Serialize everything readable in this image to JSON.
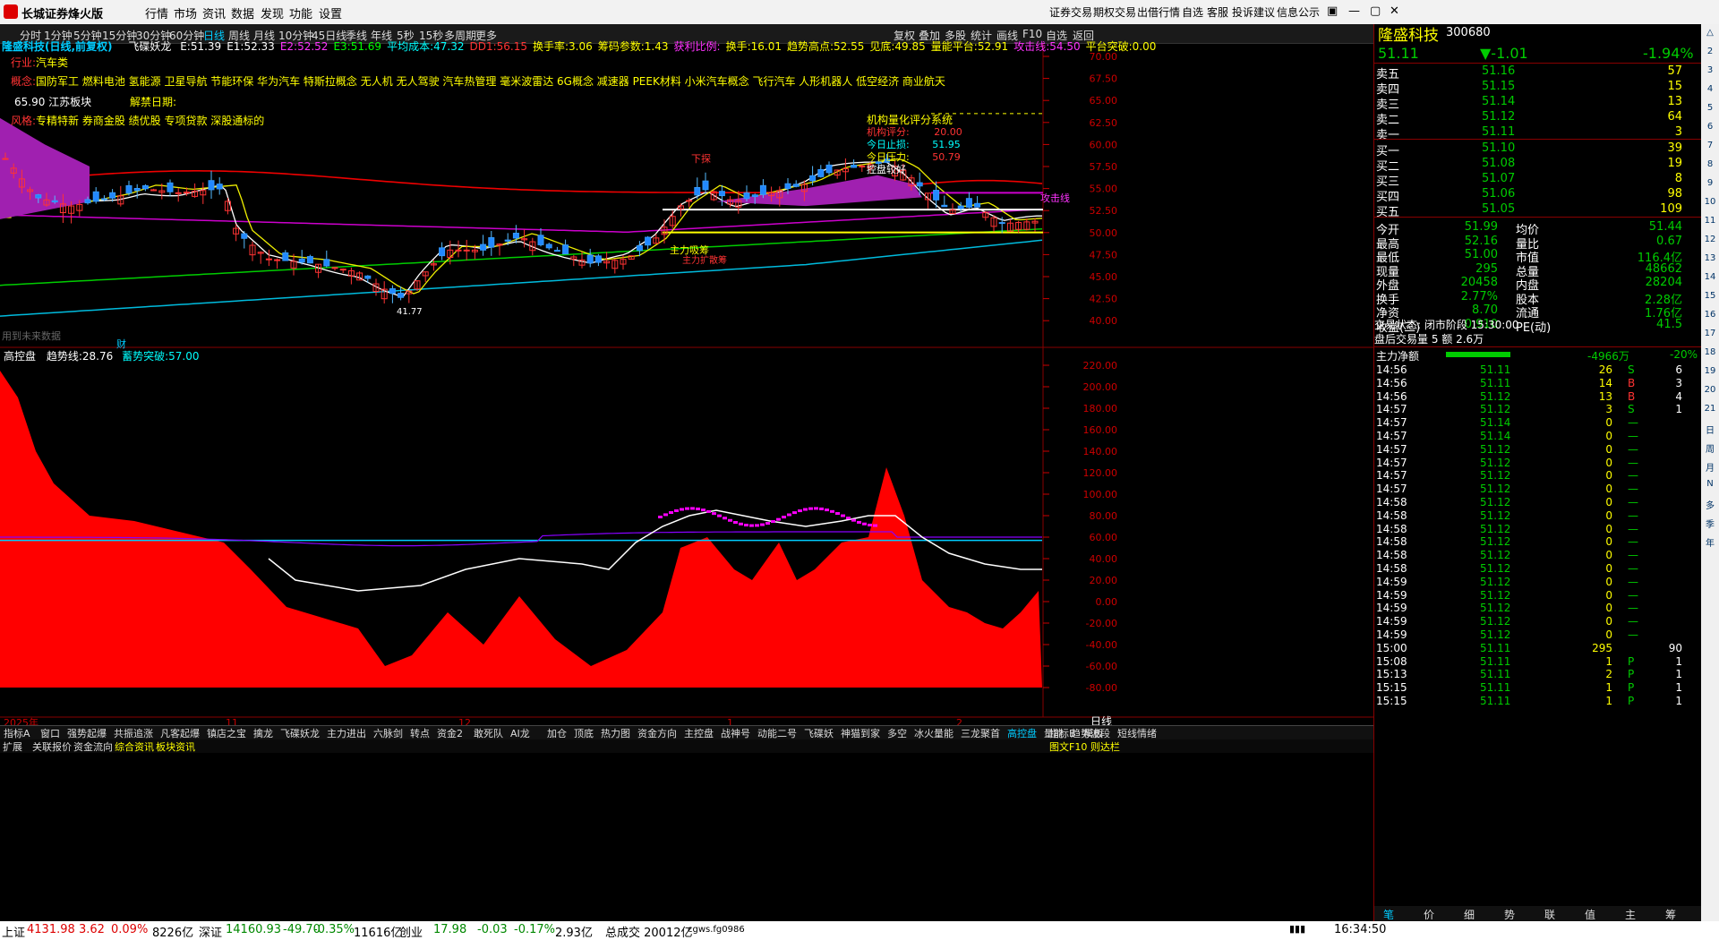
{
  "app": {
    "title": "长城证券烽火版",
    "menu": [
      "行情",
      "市场",
      "资讯",
      "数据",
      "发现",
      "功能",
      "设置"
    ],
    "links": [
      "证券交易",
      "期权交易",
      "出借行情",
      "自选",
      "客服",
      "投诉建议",
      "信息公示"
    ]
  },
  "toolbar": {
    "periods": [
      "分时",
      "1分钟",
      "5分钟",
      "15分钟",
      "30分钟",
      "60分钟",
      "日线",
      "周线",
      "月线",
      "10分钟",
      "45日线",
      "季线",
      "年线",
      "5秒",
      "15秒",
      "多周期",
      "更多"
    ],
    "right": [
      "复权",
      "叠加",
      "多股",
      "统计",
      "画线",
      "F10",
      "自选",
      "返回"
    ]
  },
  "main_info": {
    "name": "隆盛科技(日线,前复权)",
    "indicator": "飞碟妖龙",
    "values": [
      {
        "k": "E:",
        "v": "51.39",
        "c": "#fff"
      },
      {
        "k": "E1:",
        "v": "52.33",
        "c": "#fff"
      },
      {
        "k": "E2:",
        "v": "52.52",
        "c": "#f3f"
      },
      {
        "k": "E3:",
        "v": "51.69",
        "c": "#0f0"
      },
      {
        "k": "平均成本:",
        "v": "47.32",
        "c": "#0ff"
      },
      {
        "k": "DD1:",
        "v": "56.15",
        "c": "#f33"
      },
      {
        "k": "换手率:",
        "v": "3.06",
        "c": "#ff0"
      },
      {
        "k": "筹码参数:",
        "v": "1.43",
        "c": "#ff0"
      },
      {
        "k": "获利比例:",
        "v": "",
        "c": "#f3f"
      },
      {
        "k": "换手:",
        "v": "16.01",
        "c": "#ff0"
      },
      {
        "k": "趋势高点:",
        "v": "52.55",
        "c": "#ff0"
      },
      {
        "k": "见底:",
        "v": "49.85",
        "c": "#ff0"
      },
      {
        "k": "量能平台:",
        "v": "52.91",
        "c": "#ff0"
      },
      {
        "k": "攻击线:",
        "v": "54.50",
        "c": "#f3f"
      },
      {
        "k": "平台突破:",
        "v": "0.00",
        "c": "#ff0"
      }
    ],
    "industry_label": "行业:",
    "industry": "汽车类",
    "concept_label": "概念:",
    "concepts": "国防军工 燃料电池 氢能源 卫星导航 节能环保 华为汽车 特斯拉概念 无人机 无人驾驶 汽车热管理 毫米波雷达 6G概念 减速器 PEEK材料 小米汽车概念 飞行汽车 人形机器人 低空经济 商业航天",
    "region": "65.90 江苏板块",
    "unlock": "解禁日期:",
    "style_label": "风格:",
    "styles": "专精特新 券商金股 绩优股 专项贷款 深股通标的",
    "system": "机构量化评分系统",
    "inst_label": "机构评分:",
    "inst": "20.00",
    "today_label1": "今日止损:",
    "today1": "51.95",
    "today_label2": "今日压力:",
    "today2": "50.79",
    "control": "控盘较好",
    "attack": "攻击线",
    "xiatan": "下探",
    "zhuli": "主力吸筹",
    "zhulibig": "主力扩散筹",
    "low": "41.77",
    "future": "用到未来数据",
    "cai": "财"
  },
  "y_axis_main": [
    "70.00",
    "67.50",
    "65.00",
    "62.50",
    "60.00",
    "57.50",
    "55.00",
    "52.50",
    "50.00",
    "47.50",
    "45.00",
    "42.50",
    "40.00"
  ],
  "sub_info": {
    "name": "高控盘",
    "k1": "趋势线:",
    "v1": "28.76",
    "k2": "蓄势突破:",
    "v2": "57.00"
  },
  "y_axis_sub": [
    "220.00",
    "200.00",
    "180.00",
    "160.00",
    "140.00",
    "120.00",
    "100.00",
    "80.00",
    "60.00",
    "40.00",
    "20.00",
    "0.00",
    "-20.00",
    "-40.00",
    "-60.00",
    "-80.00"
  ],
  "x_axis": [
    "2025年",
    "11",
    "12",
    "1",
    "2"
  ],
  "period_label": "日线",
  "indicator_tabs": [
    "指标A",
    "窗口",
    "强势起爆",
    "共振追涨",
    "凡客起爆",
    "镇店之宝",
    "擒龙",
    "飞碟妖龙",
    "主力进出",
    "六脉剑",
    "转点",
    "资金2",
    "敢死队",
    "AI龙",
    "加仓",
    "顶底",
    "热力图",
    "资金方向",
    "主控盘",
    "战神号",
    "动能二号",
    "飞碟妖",
    "神猫到家",
    "多空",
    "冰火量能",
    "三龙聚首",
    "高控盘",
    "量能",
    "趋势波段",
    "短线情绪"
  ],
  "indicator_right": [
    "指标B",
    "模板"
  ],
  "bottom_tabs": [
    "扩展",
    "关联报价",
    "资金流向",
    "综合资讯",
    "板块资讯"
  ],
  "bottom_right": "图文F10 则达栏",
  "stock": {
    "name": "隆盛科技",
    "code": "300680",
    "price": "51.11",
    "change": "▼-1.01",
    "pct": "-1.94%"
  },
  "asks": [
    {
      "l": "卖五",
      "p": "51.16",
      "v": "57"
    },
    {
      "l": "卖四",
      "p": "51.15",
      "v": "15"
    },
    {
      "l": "卖三",
      "p": "51.14",
      "v": "13"
    },
    {
      "l": "卖二",
      "p": "51.12",
      "v": "64"
    },
    {
      "l": "卖一",
      "p": "51.11",
      "v": "3"
    }
  ],
  "bids": [
    {
      "l": "买一",
      "p": "51.10",
      "v": "39"
    },
    {
      "l": "买二",
      "p": "51.08",
      "v": "19"
    },
    {
      "l": "买三",
      "p": "51.07",
      "v": "8"
    },
    {
      "l": "买四",
      "p": "51.06",
      "v": "98"
    },
    {
      "l": "买五",
      "p": "51.05",
      "v": "109"
    }
  ],
  "stats": [
    {
      "a": "今开",
      "b": "51.99",
      "c": "均价",
      "d": "51.44"
    },
    {
      "a": "最高",
      "b": "52.16",
      "c": "量比",
      "d": "0.67"
    },
    {
      "a": "最低",
      "b": "51.00",
      "c": "市值",
      "d": "116.4亿"
    },
    {
      "a": "现量",
      "b": "295",
      "c": "总量",
      "d": "48662"
    },
    {
      "a": "外盘",
      "b": "20458",
      "c": "内盘",
      "d": "28204"
    },
    {
      "a": "换手",
      "b": "2.77%",
      "c": "股本",
      "d": "2.28亿"
    },
    {
      "a": "净资",
      "b": "8.70",
      "c": "流通",
      "d": "1.76亿"
    },
    {
      "a": "收益(三)",
      "b": "0.910",
      "c": "PE(动)",
      "d": "41.5"
    }
  ],
  "trade_status": "交易状态: 闭市阶段 15:30:00",
  "after": "盘后交易量 5 额 2.6万",
  "net_label": "主力净额",
  "net_val": "-4966万",
  "net_pct": "-20%",
  "ticks": [
    [
      "14:56",
      "51.11",
      "26",
      "S",
      "6"
    ],
    [
      "14:56",
      "51.11",
      "14",
      "B",
      "3"
    ],
    [
      "14:56",
      "51.12",
      "13",
      "B",
      "4"
    ],
    [
      "14:57",
      "51.12",
      "3",
      "S",
      "1"
    ],
    [
      "14:57",
      "51.14",
      "0",
      "—",
      ""
    ],
    [
      "14:57",
      "51.14",
      "0",
      "—",
      ""
    ],
    [
      "14:57",
      "51.12",
      "0",
      "—",
      ""
    ],
    [
      "14:57",
      "51.12",
      "0",
      "—",
      ""
    ],
    [
      "14:57",
      "51.12",
      "0",
      "—",
      ""
    ],
    [
      "14:57",
      "51.12",
      "0",
      "—",
      ""
    ],
    [
      "14:58",
      "51.12",
      "0",
      "—",
      ""
    ],
    [
      "14:58",
      "51.12",
      "0",
      "—",
      ""
    ],
    [
      "14:58",
      "51.12",
      "0",
      "—",
      ""
    ],
    [
      "14:58",
      "51.12",
      "0",
      "—",
      ""
    ],
    [
      "14:58",
      "51.12",
      "0",
      "—",
      ""
    ],
    [
      "14:58",
      "51.12",
      "0",
      "—",
      ""
    ],
    [
      "14:59",
      "51.12",
      "0",
      "—",
      ""
    ],
    [
      "14:59",
      "51.12",
      "0",
      "—",
      ""
    ],
    [
      "14:59",
      "51.12",
      "0",
      "—",
      ""
    ],
    [
      "14:59",
      "51.12",
      "0",
      "—",
      ""
    ],
    [
      "14:59",
      "51.12",
      "0",
      "—",
      ""
    ],
    [
      "15:00",
      "51.11",
      "295",
      "",
      "90"
    ],
    [
      "15:08",
      "51.11",
      "1",
      "P",
      "1"
    ],
    [
      "15:13",
      "51.11",
      "2",
      "P",
      "1"
    ],
    [
      "15:15",
      "51.11",
      "1",
      "P",
      "1"
    ],
    [
      "15:15",
      "51.11",
      "1",
      "P",
      "1"
    ]
  ],
  "right_tabs": [
    "笔",
    "价",
    "细",
    "势",
    "联",
    "值",
    "主",
    "筹"
  ],
  "sidebar": [
    "△",
    "2",
    "3",
    "4",
    "5",
    "6",
    "7",
    "8",
    "9",
    "10",
    "11",
    "12",
    "13",
    "14",
    "15",
    "16",
    "17",
    "18",
    "19",
    "20",
    "21",
    "日",
    "周",
    "月",
    "N",
    "多",
    "季",
    "年"
  ],
  "status": {
    "sh": "上证",
    "sh_v": "4131.98",
    "sh_c": "3.62",
    "sh_p": "0.09%",
    "sh_a": "8226亿",
    "sz": "深证",
    "sz_v": "14160.93",
    "sz_c": "-49.70",
    "sz_p": "-0.35%",
    "sz_a": "11616亿",
    "cy": "创业",
    "cy_v": "17.98",
    "cy_c": "-0.03",
    "cy_p": "-0.17%",
    "cy_a": "2.93亿",
    "total": "总成交 20012亿",
    "server": "cgws.fg0986",
    "time": "16:34:50"
  }
}
